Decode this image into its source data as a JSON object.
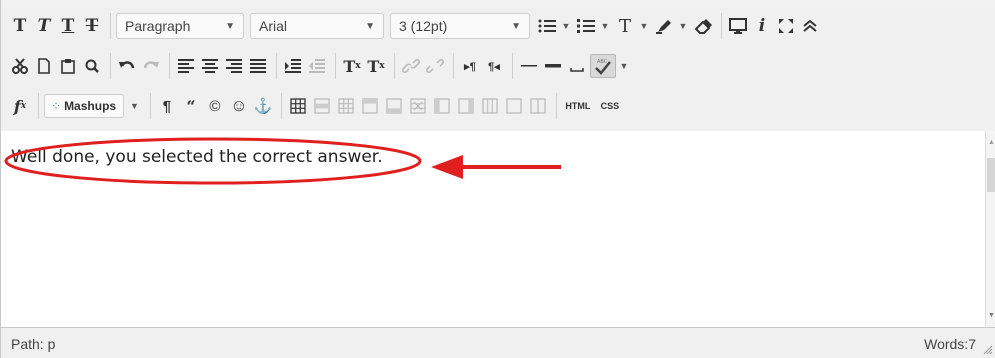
{
  "toolbar": {
    "format_select": "Paragraph",
    "font_select": "Arial",
    "size_select": "3 (12pt)",
    "mashups_label": "Mashups",
    "html_label": "HTML",
    "css_label": "CSS"
  },
  "content": {
    "paragraph": "Well done, you selected the correct answer."
  },
  "status": {
    "path_label": "Path:",
    "path_value": "p",
    "words_label": "Words:",
    "words_value": "7"
  },
  "colors": {
    "annotation_red": "#e01f1f",
    "toolbar_bg": "#f0f0f0"
  }
}
